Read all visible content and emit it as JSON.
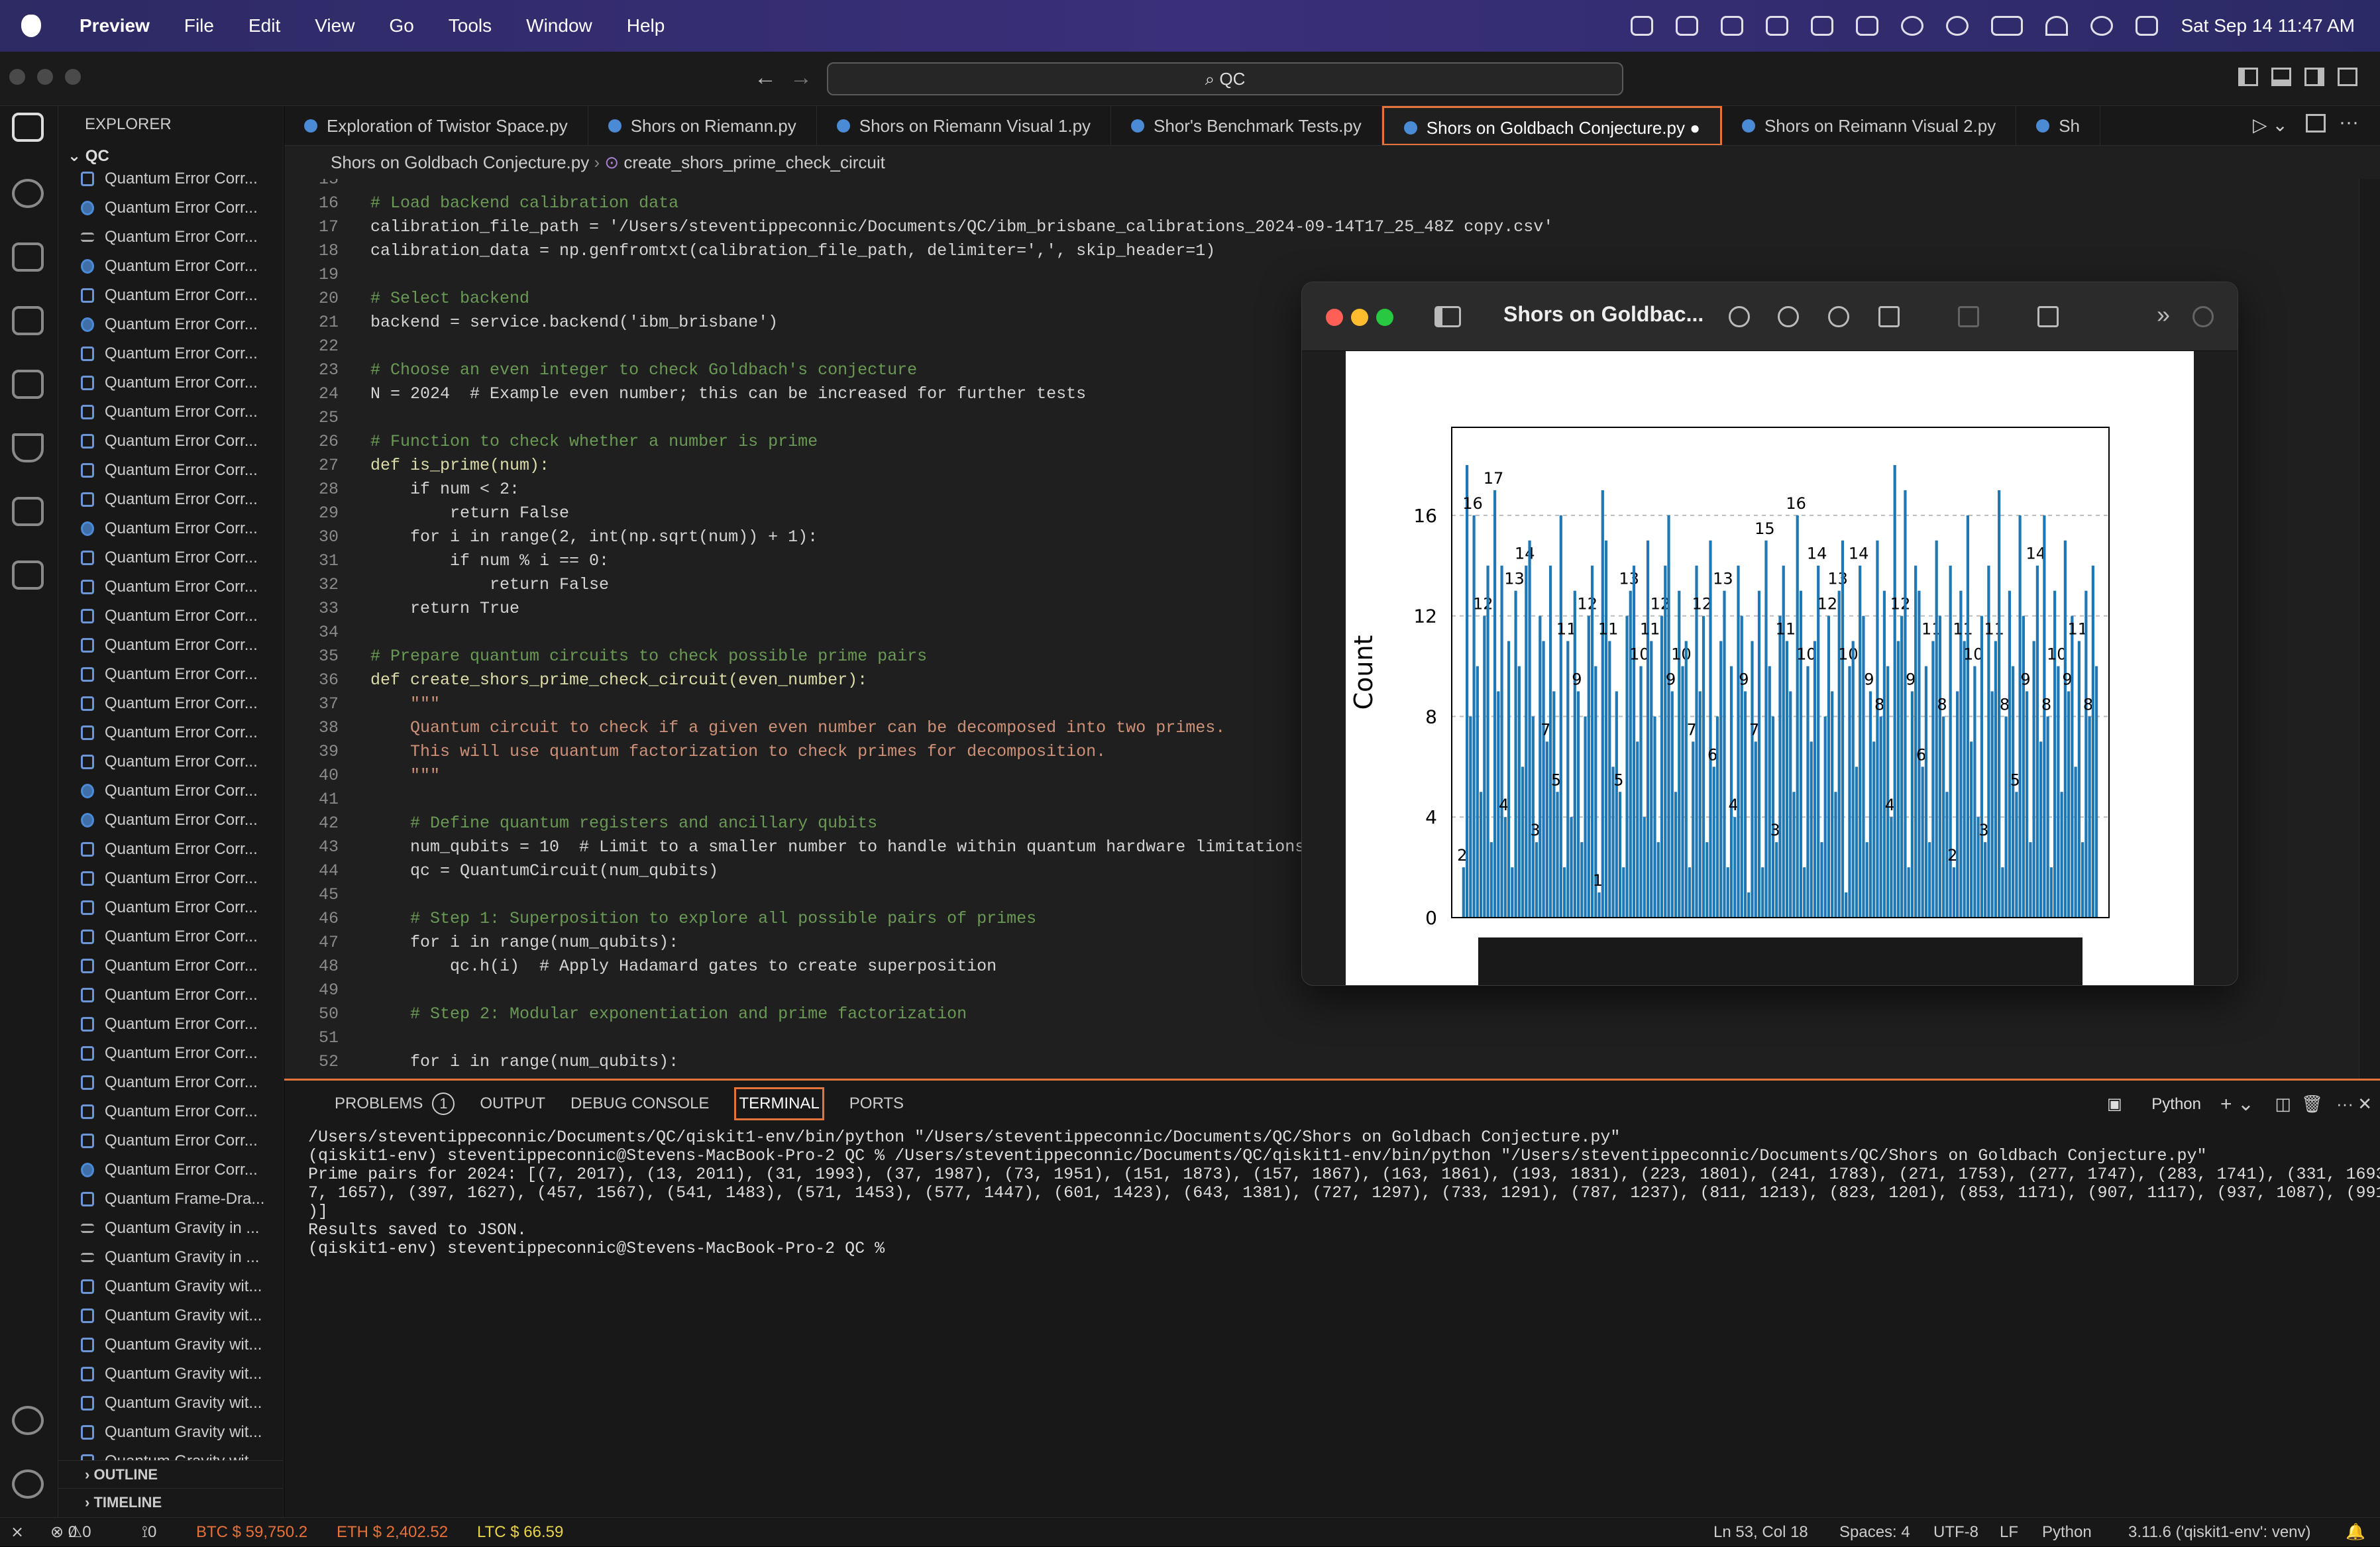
{
  "menubar": {
    "app": "Preview",
    "items": [
      "File",
      "Edit",
      "View",
      "Go",
      "Tools",
      "Window",
      "Help"
    ],
    "datetime": "Sat Sep 14  11:47 AM"
  },
  "titlebar": {
    "search": "QC"
  },
  "explorer": {
    "header": "EXPLORER",
    "root": "QC",
    "files": [
      {
        "name": "Quantum Error Corr...",
        "type": "ipynb"
      },
      {
        "name": "Quantum Error Corr...",
        "type": "py"
      },
      {
        "name": "Quantum Error Corr...",
        "type": "txt"
      },
      {
        "name": "Quantum Error Corr...",
        "type": "py"
      },
      {
        "name": "Quantum Error Corr...",
        "type": "ipynb"
      },
      {
        "name": "Quantum Error Corr...",
        "type": "py"
      },
      {
        "name": "Quantum Error Corr...",
        "type": "ipynb"
      },
      {
        "name": "Quantum Error Corr...",
        "type": "ipynb"
      },
      {
        "name": "Quantum Error Corr...",
        "type": "ipynb"
      },
      {
        "name": "Quantum Error Corr...",
        "type": "ipynb"
      },
      {
        "name": "Quantum Error Corr...",
        "type": "ipynb"
      },
      {
        "name": "Quantum Error Corr...",
        "type": "ipynb"
      },
      {
        "name": "Quantum Error Corr...",
        "type": "py"
      },
      {
        "name": "Quantum Error Corr...",
        "type": "ipynb"
      },
      {
        "name": "Quantum Error Corr...",
        "type": "ipynb"
      },
      {
        "name": "Quantum Error Corr...",
        "type": "ipynb"
      },
      {
        "name": "Quantum Error Corr...",
        "type": "ipynb"
      },
      {
        "name": "Quantum Error Corr...",
        "type": "ipynb"
      },
      {
        "name": "Quantum Error Corr...",
        "type": "ipynb"
      },
      {
        "name": "Quantum Error Corr...",
        "type": "ipynb"
      },
      {
        "name": "Quantum Error Corr...",
        "type": "ipynb"
      },
      {
        "name": "Quantum Error Corr...",
        "type": "py"
      },
      {
        "name": "Quantum Error Corr...",
        "type": "py"
      },
      {
        "name": "Quantum Error Corr...",
        "type": "ipynb"
      },
      {
        "name": "Quantum Error Corr...",
        "type": "ipynb"
      },
      {
        "name": "Quantum Error Corr...",
        "type": "ipynb"
      },
      {
        "name": "Quantum Error Corr...",
        "type": "ipynb"
      },
      {
        "name": "Quantum Error Corr...",
        "type": "ipynb"
      },
      {
        "name": "Quantum Error Corr...",
        "type": "ipynb"
      },
      {
        "name": "Quantum Error Corr...",
        "type": "ipynb"
      },
      {
        "name": "Quantum Error Corr...",
        "type": "ipynb"
      },
      {
        "name": "Quantum Error Corr...",
        "type": "ipynb"
      },
      {
        "name": "Quantum Error Corr...",
        "type": "ipynb"
      },
      {
        "name": "Quantum Error Corr...",
        "type": "ipynb"
      },
      {
        "name": "Quantum Error Corr...",
        "type": "py"
      },
      {
        "name": "Quantum Frame-Dra...",
        "type": "ipynb"
      },
      {
        "name": "Quantum Gravity in ...",
        "type": "txt"
      },
      {
        "name": "Quantum Gravity in ...",
        "type": "txt"
      },
      {
        "name": "Quantum Gravity wit...",
        "type": "ipynb"
      },
      {
        "name": "Quantum Gravity wit...",
        "type": "ipynb"
      },
      {
        "name": "Quantum Gravity wit...",
        "type": "ipynb"
      },
      {
        "name": "Quantum Gravity wit...",
        "type": "ipynb"
      },
      {
        "name": "Quantum Gravity wit...",
        "type": "ipynb"
      },
      {
        "name": "Quantum Gravity wit...",
        "type": "ipynb"
      },
      {
        "name": "Quantum Gravity wit...",
        "type": "ipynb"
      }
    ],
    "outline": "OUTLINE",
    "timeline": "TIMELINE"
  },
  "tabs": [
    {
      "label": "Exploration of Twistor Space.py",
      "active": false
    },
    {
      "label": "Shors on Riemann.py",
      "active": false
    },
    {
      "label": "Shors on Riemann Visual 1.py",
      "active": false
    },
    {
      "label": "Shor's Benchmark Tests.py",
      "active": false
    },
    {
      "label": "Shors on Goldbach Conjecture.py",
      "active": true
    },
    {
      "label": "Shors on Reimann Visual 2.py",
      "active": false
    },
    {
      "label": "Sh",
      "active": false
    }
  ],
  "breadcrumb": {
    "file": "Shors on Goldbach Conjecture.py",
    "symbol": "create_shors_prime_check_circuit"
  },
  "editor": {
    "lines": [
      {
        "n": "15",
        "t": ""
      },
      {
        "n": "16",
        "t": "# Load backend calibration data"
      },
      {
        "n": "17",
        "t": "calibration_file_path = '/Users/steventippeconnic/Documents/QC/ibm_brisbane_calibrations_2024-09-14T17_25_48Z copy.csv'"
      },
      {
        "n": "18",
        "t": "calibration_data = np.genfromtxt(calibration_file_path, delimiter=',', skip_header=1)"
      },
      {
        "n": "19",
        "t": ""
      },
      {
        "n": "20",
        "t": "# Select backend"
      },
      {
        "n": "21",
        "t": "backend = service.backend('ibm_brisbane')"
      },
      {
        "n": "22",
        "t": ""
      },
      {
        "n": "23",
        "t": "# Choose an even integer to check Goldbach's conjecture"
      },
      {
        "n": "24",
        "t": "N = 2024  # Example even number; this can be increased for further tests"
      },
      {
        "n": "25",
        "t": ""
      },
      {
        "n": "26",
        "t": "# Function to check whether a number is prime"
      },
      {
        "n": "27",
        "t": "def is_prime(num):"
      },
      {
        "n": "28",
        "t": "    if num < 2:"
      },
      {
        "n": "29",
        "t": "        return False"
      },
      {
        "n": "30",
        "t": "    for i in range(2, int(np.sqrt(num)) + 1):"
      },
      {
        "n": "31",
        "t": "        if num % i == 0:"
      },
      {
        "n": "32",
        "t": "            return False"
      },
      {
        "n": "33",
        "t": "    return True"
      },
      {
        "n": "34",
        "t": ""
      },
      {
        "n": "35",
        "t": "# Prepare quantum circuits to check possible prime pairs"
      },
      {
        "n": "36",
        "t": "def create_shors_prime_check_circuit(even_number):"
      },
      {
        "n": "37",
        "t": "    \"\"\""
      },
      {
        "n": "38",
        "t": "    Quantum circuit to check if a given even number can be decomposed into two primes."
      },
      {
        "n": "39",
        "t": "    This will use quantum factorization to check primes for decomposition."
      },
      {
        "n": "40",
        "t": "    \"\"\""
      },
      {
        "n": "41",
        "t": ""
      },
      {
        "n": "42",
        "t": "    # Define quantum registers and ancillary qubits"
      },
      {
        "n": "43",
        "t": "    num_qubits = 10  # Limit to a smaller number to handle within quantum hardware limitations"
      },
      {
        "n": "44",
        "t": "    qc = QuantumCircuit(num_qubits)"
      },
      {
        "n": "45",
        "t": ""
      },
      {
        "n": "46",
        "t": "    # Step 1: Superposition to explore all possible pairs of primes"
      },
      {
        "n": "47",
        "t": "    for i in range(num_qubits):"
      },
      {
        "n": "48",
        "t": "        qc.h(i)  # Apply Hadamard gates to create superposition"
      },
      {
        "n": "49",
        "t": ""
      },
      {
        "n": "50",
        "t": "    # Step 2: Modular exponentiation and prime factorization"
      },
      {
        "n": "51",
        "t": ""
      },
      {
        "n": "52",
        "t": "    for i in range(num_qubits):"
      }
    ]
  },
  "preview": {
    "title": "Shors on Goldbac...",
    "plot": {
      "ylabel": "Count",
      "yticks": [
        "0",
        "4",
        "8",
        "12",
        "16"
      ]
    }
  },
  "chart_data": {
    "type": "bar",
    "ylabel": "Count",
    "ylim": [
      0,
      19.5
    ],
    "values": [
      2,
      18,
      8,
      16,
      10,
      5,
      12,
      14,
      3,
      17,
      9,
      14,
      4,
      11,
      2,
      13,
      10,
      6,
      14,
      15,
      8,
      3,
      12,
      11,
      7,
      14,
      9,
      5,
      16,
      2,
      11,
      4,
      13,
      9,
      3,
      8,
      12,
      14,
      10,
      1,
      17,
      15,
      11,
      6,
      9,
      5,
      2,
      12,
      13,
      14,
      7,
      10,
      4,
      15,
      11,
      8,
      3,
      12,
      14,
      16,
      9,
      5,
      13,
      10,
      11,
      2,
      7,
      14,
      9,
      12,
      3,
      15,
      6,
      8,
      11,
      13,
      2,
      10,
      4,
      14,
      12,
      9,
      1,
      11,
      7,
      13,
      2,
      15,
      10,
      8,
      3,
      12,
      14,
      11,
      9,
      5,
      16,
      13,
      2,
      10,
      7,
      11,
      14,
      3,
      8,
      12,
      9,
      5,
      13,
      15,
      1,
      10,
      11,
      6,
      14,
      12,
      3,
      9,
      7,
      15,
      8,
      13,
      10,
      4,
      18,
      11,
      12,
      17,
      2,
      9,
      14,
      13,
      6,
      10,
      3,
      11,
      15,
      12,
      8,
      5,
      14,
      2,
      9,
      13,
      11,
      16,
      7,
      10,
      4,
      12,
      3,
      14,
      9,
      11,
      17,
      2,
      8,
      13,
      10,
      5,
      16,
      12,
      9,
      3,
      11,
      14,
      7,
      16,
      8,
      2,
      13,
      10,
      5,
      15,
      9,
      12,
      6,
      11,
      3,
      13,
      8,
      14,
      10
    ]
  },
  "panel": {
    "tabs": [
      "PROBLEMS",
      "OUTPUT",
      "DEBUG CONSOLE",
      "TERMINAL",
      "PORTS"
    ],
    "problems_count": "1",
    "active": "TERMINAL",
    "shell": "Python",
    "terminal": [
      "/Users/steventippeconnic/Documents/QC/qiskit1-env/bin/python \"/Users/steventippeconnic/Documents/QC/Shors on Goldbach Conjecture.py\"",
      "(qiskit1-env) steventippeconnic@Stevens-MacBook-Pro-2 QC % /Users/steventippeconnic/Documents/QC/qiskit1-env/bin/python \"/Users/steventippeconnic/Documents/QC/Shors on Goldbach Conjecture.py\"",
      "Prime pairs for 2024: [(7, 2017), (13, 2011), (31, 1993), (37, 1987), (73, 1951), (151, 1873), (157, 1867), (163, 1861), (193, 1831), (223, 1801), (241, 1783), (271, 1753), (277, 1747), (283, 1741), (331, 1693), (36",
      "7, 1657), (397, 1627), (457, 1567), (541, 1483), (571, 1453), (577, 1447), (601, 1423), (643, 1381), (727, 1297), (733, 1291), (787, 1237), (811, 1213), (823, 1201), (853, 1171), (907, 1117), (937, 1087), (991, 1033",
      ")]",
      "Results saved to JSON.",
      "(qiskit1-env) steventippeconnic@Stevens-MacBook-Pro-2 QC % "
    ]
  },
  "statusbar": {
    "errors": "0",
    "warnings": "0",
    "ports": "0",
    "btc": "BTC $ 59,750.2",
    "eth": "ETH $ 2,402.52",
    "ltc": "LTC $ 66.59",
    "pos": "Ln 53, Col 18",
    "spaces": "Spaces: 4",
    "enc": "UTF-8",
    "eol": "LF",
    "lang": "Python",
    "env": "3.11.6 ('qiskit1-env': venv)"
  },
  "colors": {
    "accent": "#e6723c",
    "bar": "#1f77b4",
    "menubar": "#2d2a64"
  }
}
